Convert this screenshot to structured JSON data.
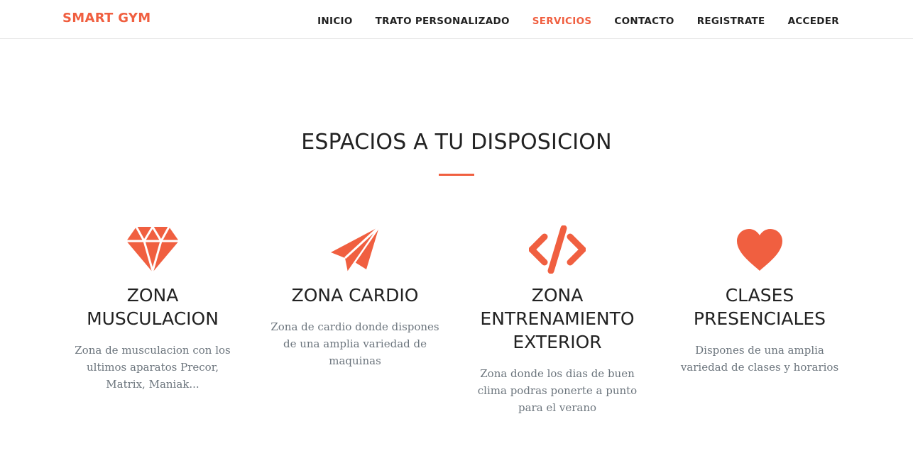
{
  "navbar": {
    "brand": "SMART GYM",
    "links": [
      {
        "label": "INICIO"
      },
      {
        "label": "TRATO PERSONALIZADO"
      },
      {
        "label": "SERVICIOS"
      },
      {
        "label": "CONTACTO"
      },
      {
        "label": "REGISTRATE"
      },
      {
        "label": "ACCEDER"
      }
    ],
    "active_link": "SERVICIOS"
  },
  "section": {
    "title": "ESPACIOS A TU DISPOSICION",
    "services": [
      {
        "icon": "diamond-icon",
        "title": "ZONA MUSCULACION",
        "description": "Zona de musculacion con los ultimos aparatos Precor, Matrix, Maniak..."
      },
      {
        "icon": "paper-plane-icon",
        "title": "ZONA CARDIO",
        "description": "Zona de cardio donde dispones de una amplia variedad de maquinas"
      },
      {
        "icon": "code-icon",
        "title": "ZONA ENTRENAMIENTO EXTERIOR",
        "description": "Zona donde los dias de buen clima podras ponerte a punto para el verano"
      },
      {
        "icon": "heart-icon",
        "title": "CLASES PRESENCIALES",
        "description": "Dispones de una amplia variedad de clases y horarios"
      }
    ]
  },
  "colors": {
    "accent": "#f05f40",
    "text_dark": "#222222",
    "text_muted": "#6c757d"
  }
}
